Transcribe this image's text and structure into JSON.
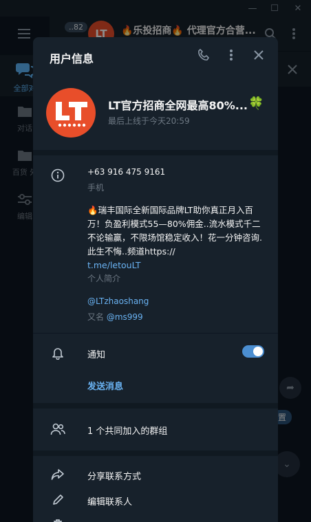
{
  "window": {
    "minimize": "—",
    "maximize": "☐",
    "close": "✕"
  },
  "folders": [
    {
      "label": "全部对",
      "badge": "",
      "active": true
    },
    {
      "label": "对话",
      "badge": ""
    },
    {
      "label": "百货 外",
      "badge": ""
    },
    {
      "label": "编辑",
      "badge": ""
    }
  ],
  "background_chat": {
    "unread": "..82",
    "avatar_text": "LT",
    "title": "🔥乐投招商🔥 代理官方合营...",
    "side_button": "置"
  },
  "modal": {
    "title": "用户信息",
    "profile": {
      "name": "LT官方招商全网最高80%...",
      "emoji": "🍀",
      "status": "最后上线于今天20:59"
    },
    "phone": {
      "value": "+63 916 475 9161",
      "label": "手机"
    },
    "bio": {
      "text": "🔥瑞丰国际全新国际品牌LT助你真正月入百万！负盈利模式55—80%佣金..流水模式千二不论输赢，不限场馆稳定收入！花一分钟咨询. 此生不悔..频道https://",
      "link": "t.me/letouLT",
      "label": "个人简介"
    },
    "username": {
      "value": "@LTzhaoshang",
      "alias_prefix": "又名",
      "alias": "@ms999"
    },
    "notifications": {
      "label": "通知",
      "enabled": true
    },
    "send_message": "发送消息",
    "groups_in_common": "1 个共同加入的群组",
    "share_contact": "分享联系方式",
    "edit_contact": "编辑联系人"
  }
}
